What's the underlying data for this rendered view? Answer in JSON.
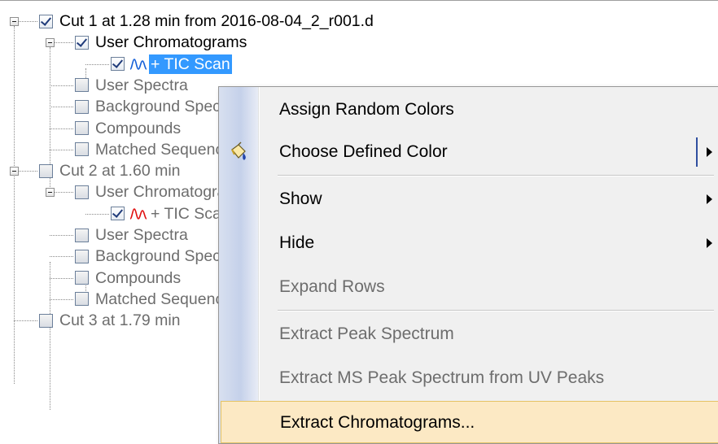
{
  "tree": {
    "rows": [
      {
        "label": "Cut 1 at 1.28 min from 2016-08-04_2_r001.d",
        "checked": true,
        "state": "enabled"
      },
      {
        "label": "User Chromatograms",
        "checked": true,
        "state": "enabled"
      },
      {
        "label": "+ TIC Scan",
        "checked": true,
        "state": "selected",
        "icon": "chromatogram-blue-icon"
      },
      {
        "label": "User Spectra",
        "checked": false,
        "state": "disabled"
      },
      {
        "label": "Background Spectra",
        "checked": false,
        "state": "disabled"
      },
      {
        "label": "Compounds",
        "checked": false,
        "state": "disabled"
      },
      {
        "label": "Matched Sequences",
        "checked": false,
        "state": "disabled"
      },
      {
        "label": "Cut 2 at 1.60 min",
        "checked": false,
        "state": "disabled"
      },
      {
        "label": "User Chromatograms",
        "checked": false,
        "state": "disabled"
      },
      {
        "label": "+ TIC Scan",
        "checked": true,
        "state": "disabled",
        "icon": "chromatogram-red-icon"
      },
      {
        "label": "User Spectra",
        "checked": false,
        "state": "disabled"
      },
      {
        "label": "Background Spectra",
        "checked": false,
        "state": "disabled"
      },
      {
        "label": "Compounds",
        "checked": false,
        "state": "disabled"
      },
      {
        "label": "Matched Sequences",
        "checked": false,
        "state": "disabled"
      },
      {
        "label": "Cut 3 at 1.79 min",
        "checked": false,
        "state": "disabled"
      }
    ]
  },
  "menu": {
    "items": [
      {
        "label": "Assign Random Colors",
        "state": "enabled"
      },
      {
        "label": "Choose Defined Color",
        "state": "enabled",
        "icon": "paint-bucket-icon",
        "submenu": true,
        "split": true
      },
      {
        "label": "Show",
        "state": "enabled",
        "submenu": true
      },
      {
        "label": "Hide",
        "state": "enabled",
        "submenu": true
      },
      {
        "label": "Expand Rows",
        "state": "disabled"
      },
      {
        "label": "Extract Peak Spectrum",
        "state": "disabled"
      },
      {
        "label": "Extract MS Peak Spectrum from UV Peaks",
        "state": "disabled"
      },
      {
        "label": "Extract Chromatograms...",
        "state": "hover"
      }
    ]
  },
  "colors": {
    "selection": "#3399ff",
    "chromatogram_blue": "#1560d8",
    "chromatogram_red": "#e01010",
    "menu_hover": "#fce9c4"
  }
}
